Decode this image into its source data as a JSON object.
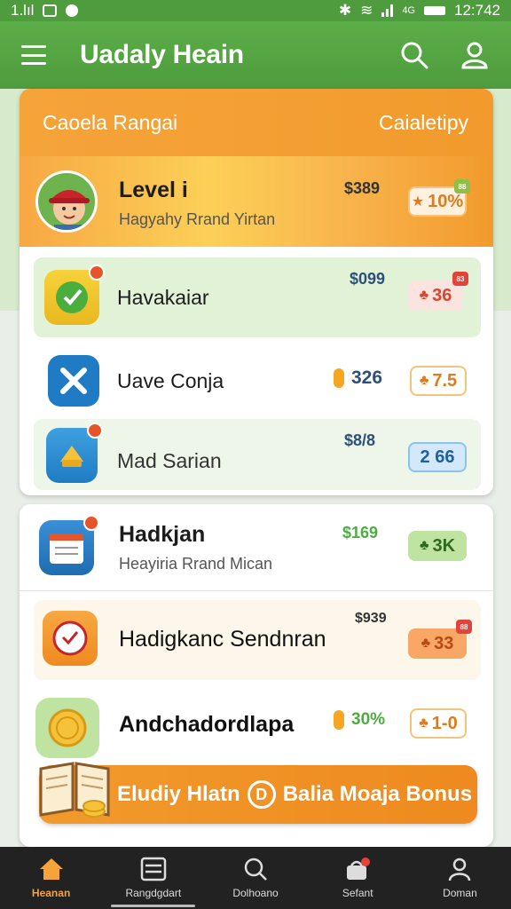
{
  "status_bar": {
    "left_text": "1.lıl",
    "time": "12:742",
    "net": "4G"
  },
  "app_bar": {
    "title": "Uadaly Heain"
  },
  "card1": {
    "header_left": "Caoela Rangai",
    "header_right": "Caialetipy",
    "rows": [
      {
        "title": "Level i",
        "subtitle": "Hagyahy Rrand Yirtan",
        "price": "$389",
        "badge": "10%",
        "badge_corner": "88"
      },
      {
        "title": "Havakaiar",
        "price": "$099",
        "badge": "36",
        "badge_corner": "83"
      },
      {
        "title": "Uave Conja",
        "price": "326",
        "badge": "7.5"
      },
      {
        "title": "Mad Sarian",
        "price": "$8/8",
        "badge": "2 66"
      }
    ]
  },
  "card2": {
    "rows": [
      {
        "title": "Hadkjan",
        "subtitle": "Heayiria Rrand Mican",
        "price": "$169",
        "badge": "3K"
      },
      {
        "title": "Hadigkanc Sendnran",
        "price": "$939",
        "badge": "33",
        "badge_corner": "88"
      },
      {
        "title": "Andchadordlapa",
        "price": "30%",
        "badge": "1-0"
      }
    ]
  },
  "bonus": {
    "left": "Eludiy Hlatn",
    "mid": "D",
    "right": "Balia Moaja Bonus"
  },
  "bottom_nav": [
    {
      "label": "Heanan",
      "icon": "home-icon",
      "active": true
    },
    {
      "label": "Rangdgdart",
      "icon": "list-icon",
      "active": false
    },
    {
      "label": "Dolhoano",
      "icon": "search-icon",
      "active": false
    },
    {
      "label": "Sefant",
      "icon": "bag-icon",
      "active": false
    },
    {
      "label": "Doman",
      "icon": "profile-icon",
      "active": false
    }
  ],
  "colors": {
    "green": "#4f9c3f",
    "orange": "#f29a2c",
    "light_green": "#d7ebcc"
  }
}
